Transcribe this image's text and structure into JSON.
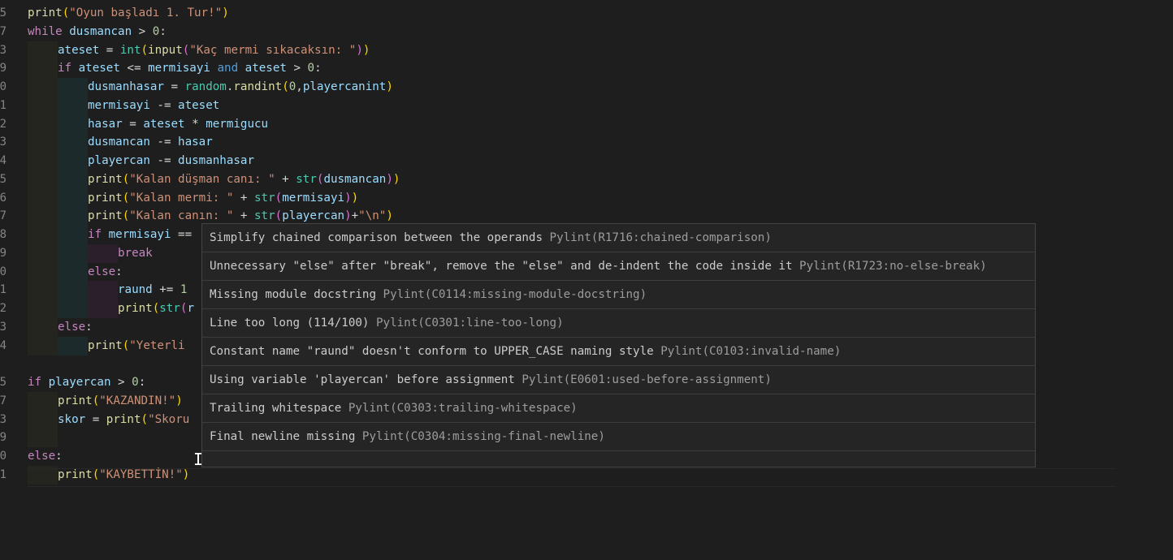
{
  "editor": {
    "gutter": [
      "5",
      "7",
      "3",
      "9",
      "0",
      "1",
      "2",
      "3",
      "4",
      "5",
      "6",
      "7",
      "8",
      "9",
      "0",
      "1",
      "2",
      "3",
      "4",
      "",
      "5",
      "7",
      "3",
      "9",
      "0",
      "1"
    ],
    "lines": [
      {
        "indent": 0,
        "tokens": [
          [
            "fn",
            "print"
          ],
          [
            "b1",
            "("
          ],
          [
            "str",
            "\"Oyun başladı 1. Tur!\""
          ],
          [
            "b1",
            ")"
          ]
        ]
      },
      {
        "indent": 0,
        "tokens": [
          [
            "kw",
            "while"
          ],
          [
            "op",
            " "
          ],
          [
            "var",
            "dusmancan"
          ],
          [
            "op",
            " > "
          ],
          [
            "num",
            "0"
          ],
          [
            "op",
            ":"
          ]
        ]
      },
      {
        "indent": 1,
        "tokens": [
          [
            "var",
            "ateset"
          ],
          [
            "op",
            " = "
          ],
          [
            "cls",
            "int"
          ],
          [
            "b1",
            "("
          ],
          [
            "fn",
            "input"
          ],
          [
            "b2",
            "("
          ],
          [
            "str",
            "\"Kaç mermi sıkacaksın: \""
          ],
          [
            "b2",
            ")"
          ],
          [
            "b1",
            ")"
          ]
        ]
      },
      {
        "indent": 1,
        "tokens": [
          [
            "kw",
            "if"
          ],
          [
            "op",
            " "
          ],
          [
            "var",
            "ateset"
          ],
          [
            "op",
            " <= "
          ],
          [
            "var",
            "mermisayi"
          ],
          [
            "op",
            " "
          ],
          [
            "kw2",
            "and"
          ],
          [
            "op",
            " "
          ],
          [
            "var",
            "ateset"
          ],
          [
            "op",
            " > "
          ],
          [
            "num",
            "0"
          ],
          [
            "op",
            ":"
          ]
        ]
      },
      {
        "indent": 2,
        "tokens": [
          [
            "var",
            "dusmanhasar"
          ],
          [
            "op",
            " = "
          ],
          [
            "cls",
            "random"
          ],
          [
            "op",
            "."
          ],
          [
            "fn",
            "randint"
          ],
          [
            "b1",
            "("
          ],
          [
            "num",
            "0"
          ],
          [
            "op",
            ","
          ],
          [
            "var",
            "playercanint"
          ],
          [
            "b1",
            ")"
          ]
        ]
      },
      {
        "indent": 2,
        "tokens": [
          [
            "var",
            "mermisayi"
          ],
          [
            "op",
            " -= "
          ],
          [
            "var",
            "ateset"
          ]
        ]
      },
      {
        "indent": 2,
        "tokens": [
          [
            "var",
            "hasar"
          ],
          [
            "op",
            " = "
          ],
          [
            "var",
            "ateset"
          ],
          [
            "op",
            " * "
          ],
          [
            "var",
            "mermigucu"
          ]
        ]
      },
      {
        "indent": 2,
        "tokens": [
          [
            "var",
            "dusmancan"
          ],
          [
            "op",
            " -= "
          ],
          [
            "var",
            "hasar"
          ]
        ]
      },
      {
        "indent": 2,
        "tokens": [
          [
            "var",
            "playercan"
          ],
          [
            "op",
            " -= "
          ],
          [
            "var",
            "dusmanhasar"
          ]
        ]
      },
      {
        "indent": 2,
        "tokens": [
          [
            "fn",
            "print"
          ],
          [
            "b1",
            "("
          ],
          [
            "str",
            "\"Kalan düşman canı: \""
          ],
          [
            "op",
            " + "
          ],
          [
            "cls",
            "str"
          ],
          [
            "b2",
            "("
          ],
          [
            "var",
            "dusmancan"
          ],
          [
            "b2",
            ")"
          ],
          [
            "b1",
            ")"
          ]
        ]
      },
      {
        "indent": 2,
        "tokens": [
          [
            "fn",
            "print"
          ],
          [
            "b1",
            "("
          ],
          [
            "str",
            "\"Kalan mermi: \""
          ],
          [
            "op",
            " + "
          ],
          [
            "cls",
            "str"
          ],
          [
            "b2",
            "("
          ],
          [
            "var",
            "mermisayi"
          ],
          [
            "b2",
            ")"
          ],
          [
            "b1",
            ")"
          ]
        ]
      },
      {
        "indent": 2,
        "tokens": [
          [
            "fn",
            "print"
          ],
          [
            "b1",
            "("
          ],
          [
            "str",
            "\"Kalan canın: \""
          ],
          [
            "op",
            " + "
          ],
          [
            "cls",
            "str"
          ],
          [
            "b2",
            "("
          ],
          [
            "var",
            "playercan"
          ],
          [
            "b2",
            ")"
          ],
          [
            "op",
            "+"
          ],
          [
            "str",
            "\"\\n\""
          ],
          [
            "b1",
            ")"
          ]
        ]
      },
      {
        "indent": 2,
        "tokens": [
          [
            "kw",
            "if"
          ],
          [
            "op",
            " "
          ],
          [
            "var",
            "mermisayi"
          ],
          [
            "op",
            " =="
          ]
        ]
      },
      {
        "indent": 3,
        "tokens": [
          [
            "kw",
            "break"
          ]
        ]
      },
      {
        "indent": 2,
        "tokens": [
          [
            "kw",
            "else"
          ],
          [
            "op",
            ":"
          ]
        ]
      },
      {
        "indent": 3,
        "tokens": [
          [
            "var",
            "raund"
          ],
          [
            "op",
            " += "
          ],
          [
            "num",
            "1"
          ]
        ]
      },
      {
        "indent": 3,
        "tokens": [
          [
            "fn",
            "print"
          ],
          [
            "b1",
            "("
          ],
          [
            "cls",
            "str"
          ],
          [
            "b2",
            "("
          ],
          [
            "var",
            "r"
          ]
        ]
      },
      {
        "indent": 1,
        "tokens": [
          [
            "kw",
            "else"
          ],
          [
            "op",
            ":"
          ]
        ]
      },
      {
        "indent": 2,
        "tokens": [
          [
            "fn",
            "print"
          ],
          [
            "b1",
            "("
          ],
          [
            "str",
            "\"Yeterli"
          ]
        ]
      },
      {
        "indent": 0,
        "tokens": []
      },
      {
        "indent": 0,
        "tokens": [
          [
            "kw",
            "if"
          ],
          [
            "op",
            " "
          ],
          [
            "var",
            "playercan"
          ],
          [
            "op",
            " > "
          ],
          [
            "num",
            "0"
          ],
          [
            "op",
            ":"
          ]
        ]
      },
      {
        "indent": 1,
        "tokens": [
          [
            "fn",
            "print"
          ],
          [
            "b1",
            "("
          ],
          [
            "str",
            "\"KAZANDIN!\""
          ],
          [
            "b1",
            ")"
          ]
        ]
      },
      {
        "indent": 1,
        "tokens": [
          [
            "var",
            "skor"
          ],
          [
            "op",
            " = "
          ],
          [
            "fn",
            "print"
          ],
          [
            "b1",
            "("
          ],
          [
            "str",
            "\"Skoru"
          ]
        ]
      },
      {
        "indent": 1,
        "tokens": []
      },
      {
        "indent": 0,
        "tokens": [
          [
            "kw",
            "else"
          ],
          [
            "op",
            ":"
          ]
        ]
      },
      {
        "indent": 1,
        "tokens": [
          [
            "fn",
            "print"
          ],
          [
            "b1",
            "("
          ],
          [
            "str",
            "\"KAYBETTİN!\""
          ],
          [
            "b1",
            ")"
          ]
        ]
      }
    ]
  },
  "hover": {
    "diagnostics": [
      {
        "message": "Simplify chained comparison between the operands",
        "source": "Pylint(R1716:chained-comparison)"
      },
      {
        "message": "Unnecessary \"else\" after \"break\", remove the \"else\" and de-indent the code inside it",
        "source": "Pylint(R1723:no-else-break)"
      },
      {
        "message": "Missing module docstring",
        "source": "Pylint(C0114:missing-module-docstring)"
      },
      {
        "message": "Line too long (114/100)",
        "source": "Pylint(C0301:line-too-long)"
      },
      {
        "message": "Constant name \"raund\" doesn't conform to UPPER_CASE naming style",
        "source": "Pylint(C0103:invalid-name)"
      },
      {
        "message": "Using variable 'playercan' before assignment",
        "source": "Pylint(E0601:used-before-assignment)"
      },
      {
        "message": "Trailing whitespace",
        "source": "Pylint(C0303:trailing-whitespace)"
      },
      {
        "message": "Final newline missing",
        "source": "Pylint(C0304:missing-final-newline)"
      }
    ]
  },
  "caret_glyph": "I"
}
